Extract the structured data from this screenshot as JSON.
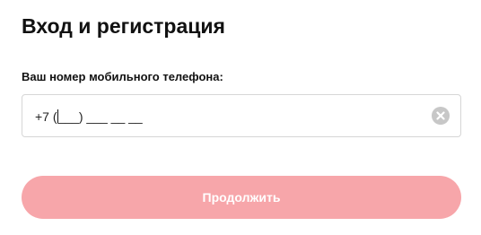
{
  "header": {
    "title": "Вход и регистрация"
  },
  "form": {
    "phone_label": "Ваш номер мобильного телефона:",
    "phone_prefix": "+7 (",
    "phone_mask": "___) ___ __ __",
    "clear_icon": "clear-circle-icon",
    "continue_label": "Продолжить",
    "continue_enabled": false
  },
  "colors": {
    "button_disabled": "#f7a6aa",
    "clear_icon": "#c7c7c7",
    "input_border": "#d6d6d6"
  }
}
